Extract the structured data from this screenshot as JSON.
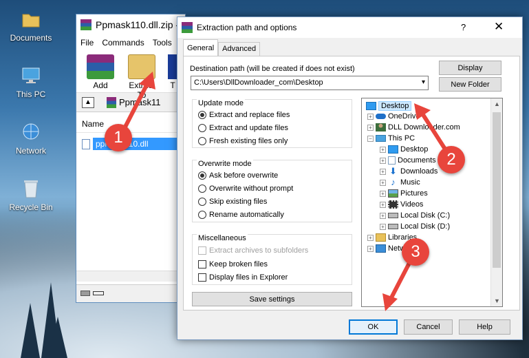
{
  "desktop": {
    "icons": [
      {
        "label": "Documents",
        "icon": "folder-icon"
      },
      {
        "label": "This PC",
        "icon": "computer-icon"
      },
      {
        "label": "Network",
        "icon": "network-icon"
      },
      {
        "label": "Recycle Bin",
        "icon": "recycle-bin-icon"
      }
    ]
  },
  "winrar": {
    "title": "Ppmask110.dll.zip -",
    "menu": [
      "File",
      "Commands",
      "Tools"
    ],
    "toolbar": {
      "add": "Add",
      "extract_to": "Extract To",
      "next": "T"
    },
    "path": "Ppmask11",
    "column_name": "Name",
    "file": "ppmask110.dll"
  },
  "dialog": {
    "title": "Extraction path and options",
    "help": "?",
    "close": "✕",
    "tabs": {
      "general": "General",
      "advanced": "Advanced"
    },
    "dest_label": "Destination path (will be created if does not exist)",
    "dest_value": "C:\\Users\\DllDownloader_com\\Desktop",
    "display_btn": "Display",
    "new_folder_btn": "New Folder",
    "update_mode": {
      "title": "Update mode",
      "options": [
        "Extract and replace files",
        "Extract and update files",
        "Fresh existing files only"
      ],
      "selected": 0
    },
    "overwrite_mode": {
      "title": "Overwrite mode",
      "options": [
        "Ask before overwrite",
        "Overwrite without prompt",
        "Skip existing files",
        "Rename automatically"
      ],
      "selected": 0
    },
    "misc": {
      "title": "Miscellaneous",
      "options": [
        "Extract archives to subfolders",
        "Keep broken files",
        "Display files in Explorer"
      ]
    },
    "save_settings": "Save settings",
    "tree": [
      {
        "label": "Desktop",
        "selected": true
      },
      {
        "label": "OneDrive"
      },
      {
        "label": "DLL Downloader.com"
      },
      {
        "label": "This PC"
      },
      {
        "label": "Desktop"
      },
      {
        "label": "Documents"
      },
      {
        "label": "Downloads"
      },
      {
        "label": "Music"
      },
      {
        "label": "Pictures"
      },
      {
        "label": "Videos"
      },
      {
        "label": "Local Disk (C:)"
      },
      {
        "label": "Local Disk (D:)"
      },
      {
        "label": "Libraries"
      },
      {
        "label": "Network"
      }
    ],
    "ok": "OK",
    "cancel": "Cancel",
    "help_btn": "Help"
  },
  "markers": [
    "1",
    "2",
    "3"
  ],
  "colors": {
    "selection": "#3399ff",
    "marker": "#e8453c",
    "accent": "#0078d7"
  }
}
